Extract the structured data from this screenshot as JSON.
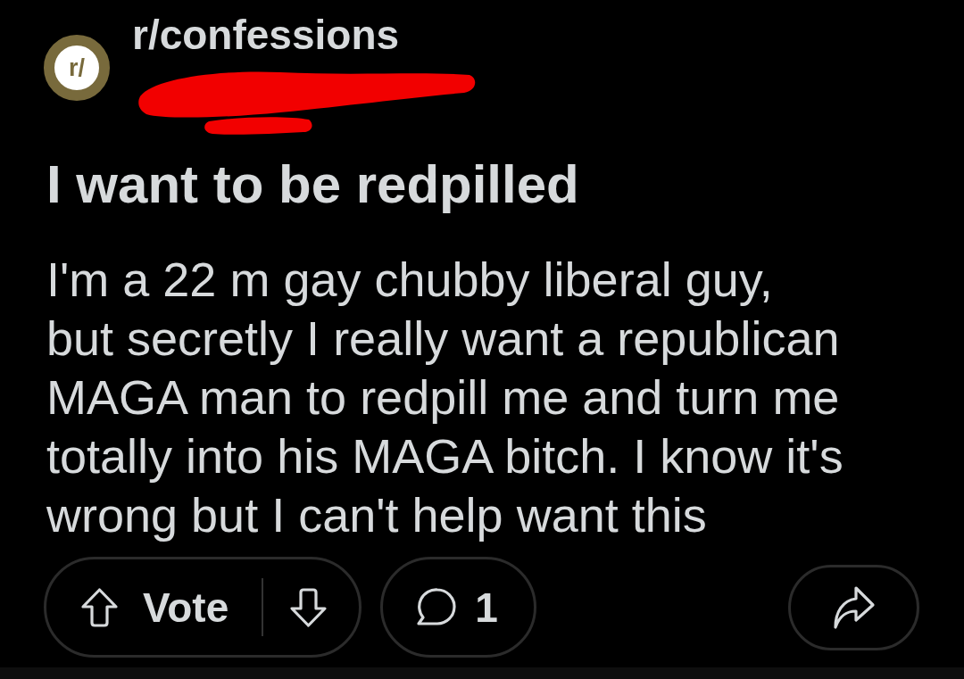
{
  "post": {
    "subreddit": {
      "avatar_text": "r/",
      "name": "r/confessions"
    },
    "title": "I want to be redpilled",
    "body": "I'm a 22 m gay chubby liberal guy,\nbut secretly I really want a republican MAGA man to redpill me and turn me totally into his MAGA bitch. I know it's wrong but I can't help want this"
  },
  "actions": {
    "vote_label": "Vote",
    "comment_count": "1"
  }
}
